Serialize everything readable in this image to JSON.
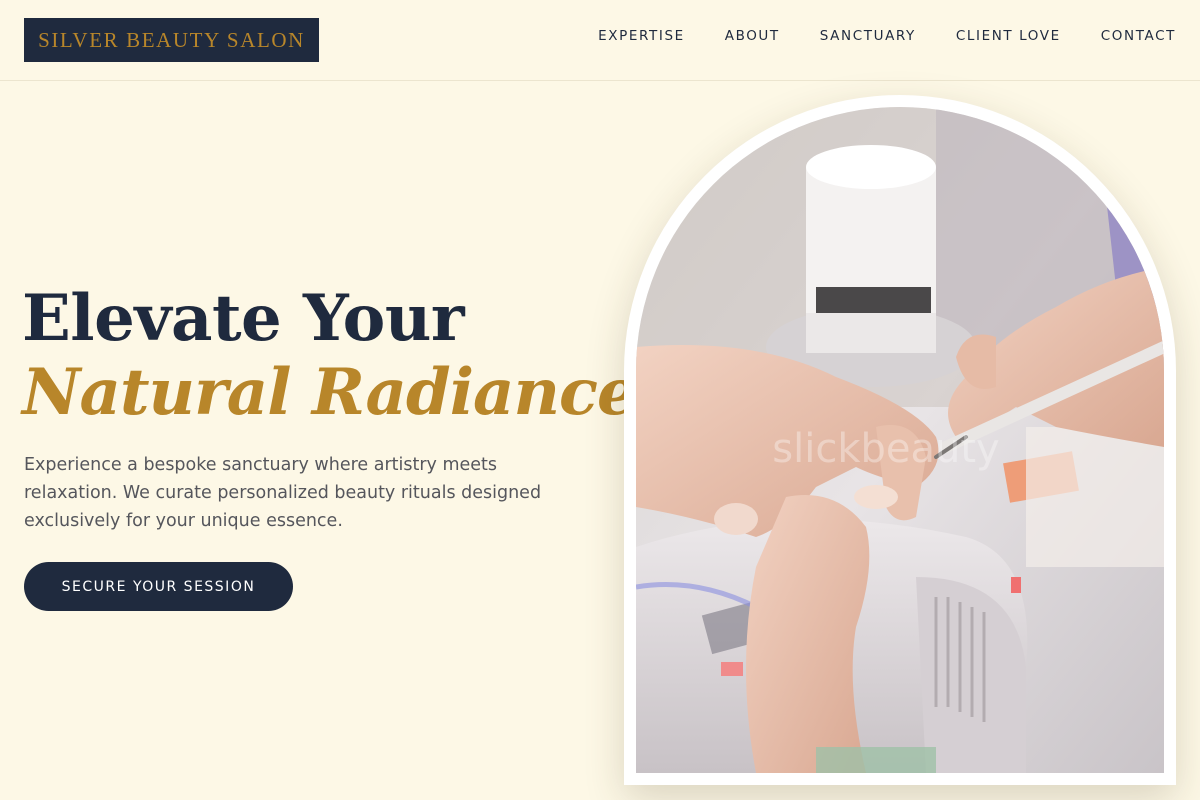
{
  "brand": {
    "name": "SILVER BEAUTY SALON"
  },
  "nav": {
    "items": [
      {
        "label": "EXPERTISE"
      },
      {
        "label": "ABOUT"
      },
      {
        "label": "SANCTUARY"
      },
      {
        "label": "CLIENT LOVE"
      },
      {
        "label": "CONTACT"
      }
    ]
  },
  "hero": {
    "title_line1": "Elevate Your",
    "title_line2": "Natural Radiance",
    "subtitle": "Experience a bespoke sanctuary where artistry meets relaxation. We curate personalized beauty rituals designed exclusively for your unique essence.",
    "cta_label": "SECURE YOUR SESSION"
  },
  "image": {
    "watermark": "slickbeauty"
  },
  "colors": {
    "navy": "#1f2a3e",
    "gold": "#b8862a",
    "cream": "#fdf8e6"
  }
}
